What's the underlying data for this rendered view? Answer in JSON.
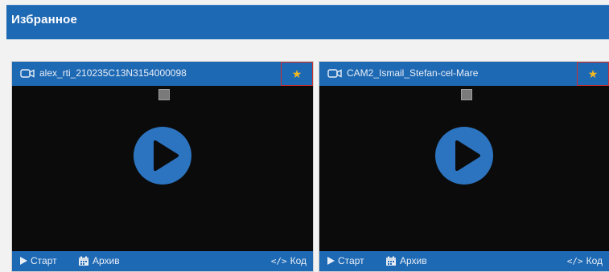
{
  "header": {
    "title": "Избранное"
  },
  "cameras": [
    {
      "name": "alex_rti_210235C13N3154000098",
      "favorite": true,
      "start_label": "Старт",
      "archive_label": "Архив",
      "code_label": "Код",
      "code_icon": "</>"
    },
    {
      "name": "CAM2_Ismail_Stefan-cel-Mare",
      "favorite": true,
      "start_label": "Старт",
      "archive_label": "Архив",
      "code_label": "Код",
      "code_icon": "</>"
    }
  ],
  "icons": {
    "star": "★",
    "camera": "camera-icon",
    "play": "play-icon",
    "calendar": "calendar-icon"
  },
  "colors": {
    "brand_blue": "#1e69b4",
    "star": "#f3b821",
    "favorite_border": "#c93030",
    "video_bg": "#0b0b0b",
    "play_circle": "#2c74c0"
  }
}
